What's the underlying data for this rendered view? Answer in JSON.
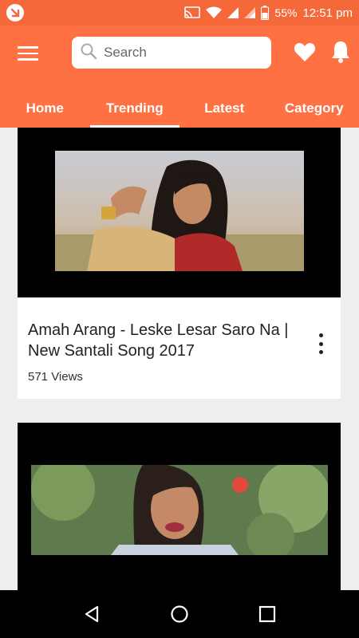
{
  "status_bar": {
    "battery": "55%",
    "time": "12:51 pm"
  },
  "header": {
    "search_placeholder": "Search",
    "tabs": [
      {
        "label": "Home"
      },
      {
        "label": "Trending"
      },
      {
        "label": "Latest"
      },
      {
        "label": "Category"
      }
    ]
  },
  "feed": {
    "items": [
      {
        "title": "Amah Arang - Leske Lesar Saro Na | New Santali Song 2017",
        "views": "571 Views"
      }
    ]
  },
  "colors": {
    "status_bar": "#f4683a",
    "app_bar": "#ff7043",
    "background": "#eeeeee"
  }
}
